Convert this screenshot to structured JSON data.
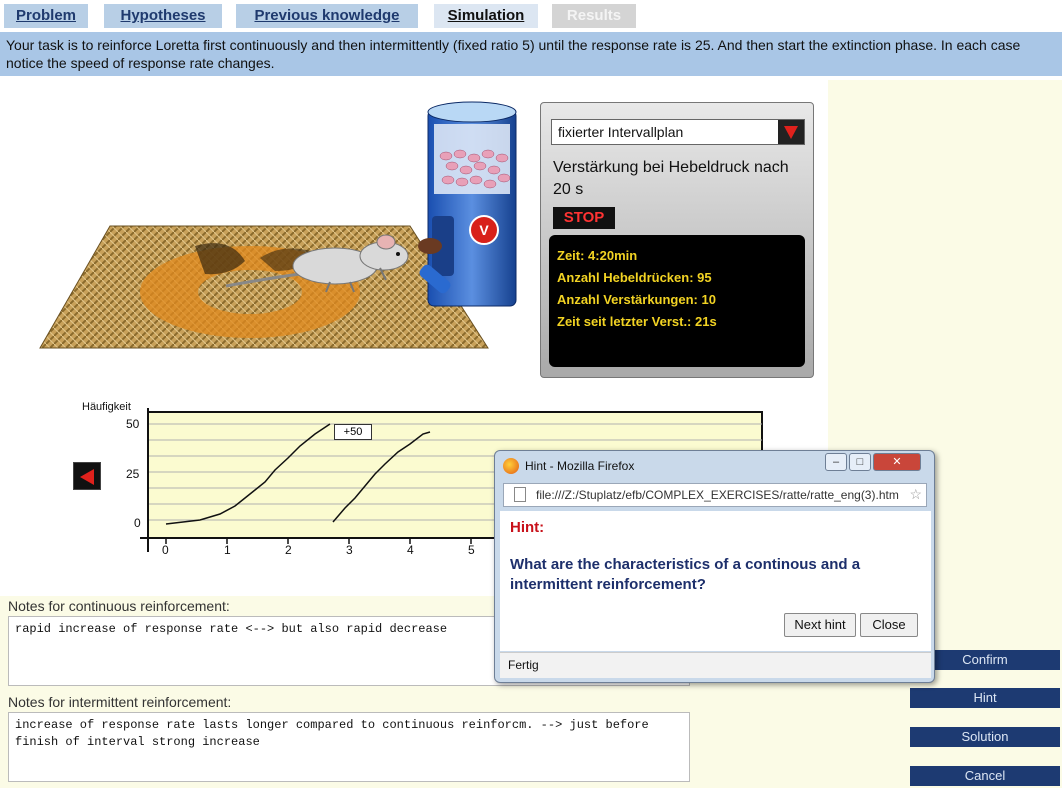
{
  "tabs": [
    "Problem",
    "Hypotheses",
    "Previous knowledge",
    "Simulation",
    "Results"
  ],
  "task": "Your task is to reinforce Loretta first continuously and then intermittently (fixed ratio 5) until the response rate is 25. And then start the extinction phase. In each case notice the speed of response rate changes.",
  "control": {
    "schedule": "fixierter Intervallplan",
    "description": "Verstärkung bei Hebeldruck nach 20 s",
    "stop_label": "STOP",
    "info": [
      "Zeit: 4:20min",
      "Anzahl Hebeldrücken: 95",
      "Anzahl Verstärkungen: 10",
      "Zeit seit letzter Verst.: 21s"
    ]
  },
  "dispenser_label": "V",
  "chart": {
    "ylabel": "Häufigkeit",
    "yticks": [
      "50",
      "25",
      "0"
    ],
    "xticks": [
      "0",
      "1",
      "2",
      "3",
      "4",
      "5"
    ],
    "annotation": "+50"
  },
  "notes": {
    "continuous_label": "Notes for continuous reinforcement:",
    "continuous_text": "rapid increase of response rate <--> but also rapid decrease",
    "intermittent_label": "Notes for intermittent reinforcement:",
    "intermittent_text": "increase of response rate lasts longer compared to continuous reinforcm. --> just before finish of interval strong increase"
  },
  "side_buttons": [
    "Confirm",
    "Hint",
    "Solution",
    "Cancel"
  ],
  "popup": {
    "title": "Hint - Mozilla Firefox",
    "url": "file:///Z:/Stuplatz/efb/COMPLEX_EXERCISES/ratte/ratte_eng(3).htm",
    "hint_heading": "Hint:",
    "hint_text": "What are the characteristics of a continous and a intermittent reinforcement?",
    "next_label": "Next hint",
    "close_label": "Close",
    "status": "Fertig"
  }
}
